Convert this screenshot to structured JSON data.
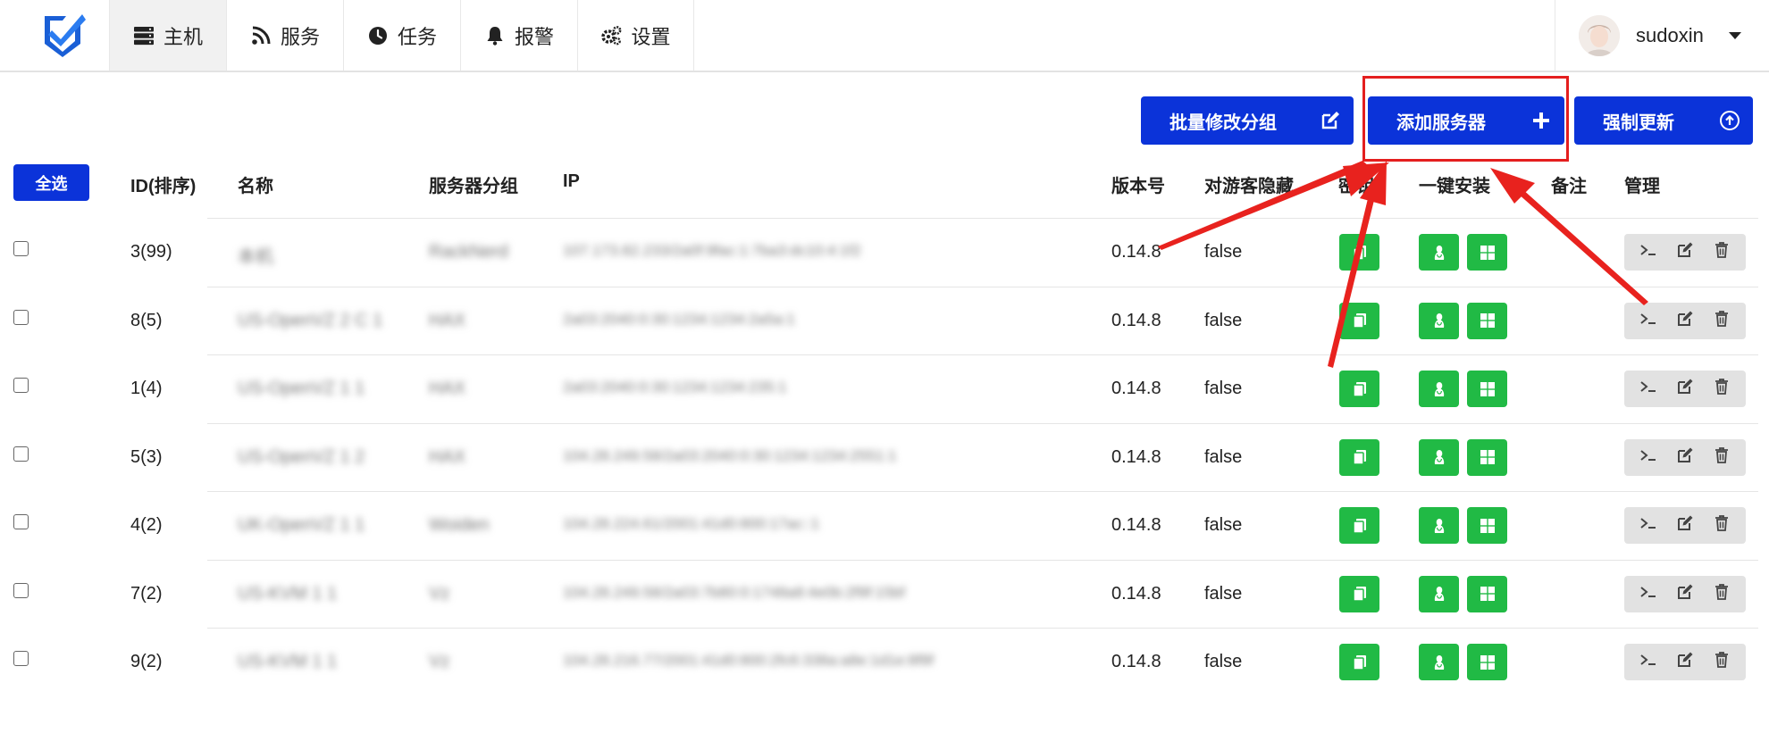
{
  "nav": {
    "items": [
      {
        "label": "主机",
        "icon": "server-icon",
        "active": true
      },
      {
        "label": "服务",
        "icon": "rss-icon",
        "active": false
      },
      {
        "label": "任务",
        "icon": "clock-icon",
        "active": false
      },
      {
        "label": "报警",
        "icon": "bell-icon",
        "active": false
      },
      {
        "label": "设置",
        "icon": "gears-icon",
        "active": false
      }
    ]
  },
  "user": {
    "name": "sudoxin"
  },
  "actions": {
    "batch_group": "批量修改分组",
    "add_server": "添加服务器",
    "force_update": "强制更新"
  },
  "table": {
    "select_all": "全选",
    "headers": {
      "id": "ID(排序)",
      "name": "名称",
      "group": "服务器分组",
      "ip": "IP",
      "version": "版本号",
      "hide": "对游客隐藏",
      "secret": "密钥",
      "install": "一键安装",
      "note": "备注",
      "manage": "管理"
    },
    "rows": [
      {
        "id": "3(99)",
        "name": "本机",
        "group": "RackNerd",
        "ip": "107.173.82.233/2a0f:9fac:1:7ba3:dc10:4:1f2",
        "version": "0.14.8",
        "hide": "false"
      },
      {
        "id": "8(5)",
        "name": "US-OpenVZ 2 C 1",
        "group": "HAX",
        "ip": "2a03:2040:0:30:1234:1234:2a5a:1",
        "version": "0.14.8",
        "hide": "false"
      },
      {
        "id": "1(4)",
        "name": "US-OpenVZ 1 1",
        "group": "HAX",
        "ip": "2a03:2040:0:30:1234:1234:235:1",
        "version": "0.14.8",
        "hide": "false"
      },
      {
        "id": "5(3)",
        "name": "US-OpenVZ 1 2",
        "group": "HAX",
        "ip": "104.28.249.58/2a03:2040:0:30:1234:1234:2551:1",
        "version": "0.14.8",
        "hide": "false"
      },
      {
        "id": "4(2)",
        "name": "UK-OpenVZ 1 1",
        "group": "Woiden",
        "ip": "104.28.224.61/2001:41d0:800:17ac::1",
        "version": "0.14.8",
        "hide": "false"
      },
      {
        "id": "7(2)",
        "name": "US-KVM 1 1",
        "group": "Vz",
        "ip": "104.28.249.58/2a03:7b80:0:1748a8:4e0b:2f9f:15bf",
        "version": "0.14.8",
        "hide": "false"
      },
      {
        "id": "9(2)",
        "name": "US-KVM 1 1",
        "group": "Vz",
        "ip": "104.28.216.77/2001:41d0:800:2fc6:338a:a8e:1d1e:8f9f",
        "version": "0.14.8",
        "hide": "false"
      }
    ]
  },
  "colors": {
    "primary": "#0b33d9",
    "green": "#21ba45",
    "annotation": "#e41e1e"
  }
}
